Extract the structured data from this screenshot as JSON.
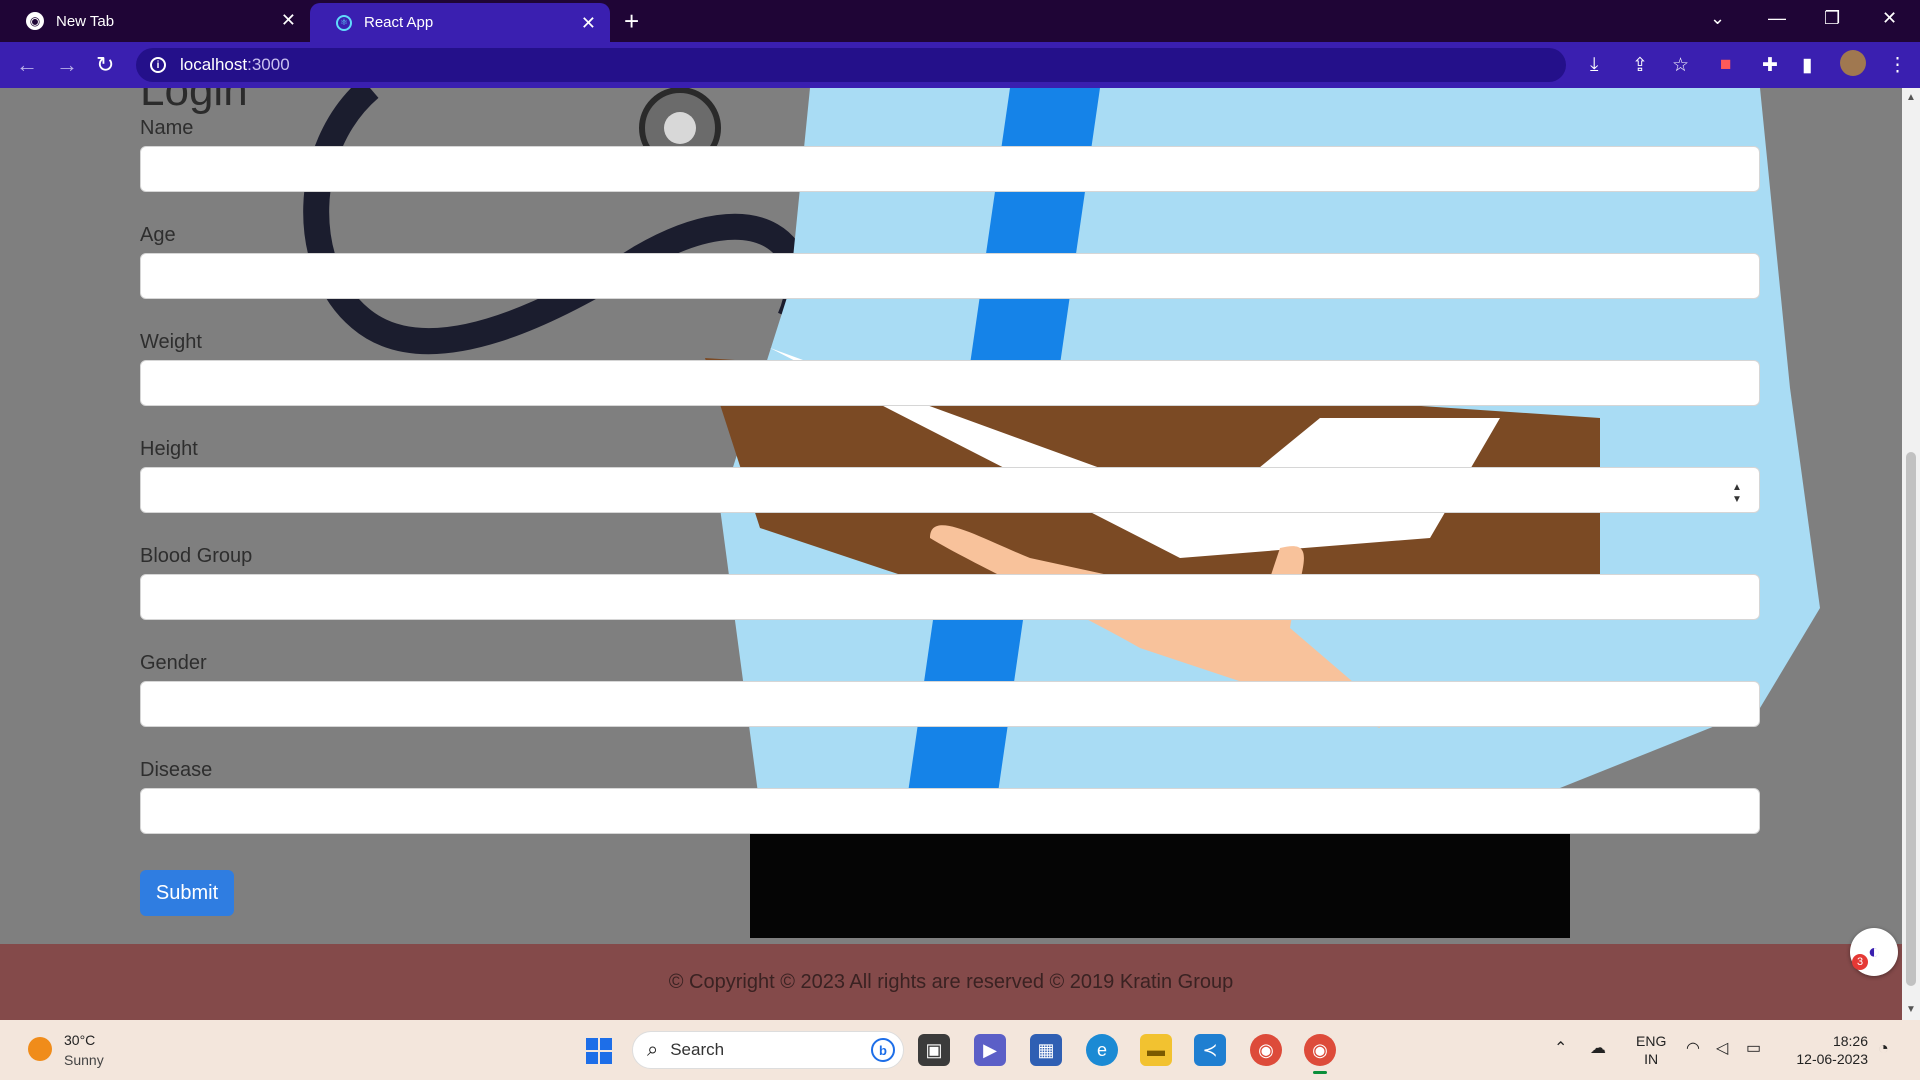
{
  "browser": {
    "tabs": [
      {
        "title": "New Tab",
        "icon": "chrome-icon",
        "active": false
      },
      {
        "title": "React App",
        "icon": "react-icon",
        "active": true
      }
    ],
    "url_host": "localhost",
    "url_port": ":3000",
    "accent_color": "#3a1fb0"
  },
  "page": {
    "title": "Login",
    "form": {
      "fields": [
        {
          "label": "Name",
          "value": ""
        },
        {
          "label": "Age",
          "value": ""
        },
        {
          "label": "Weight",
          "value": ""
        },
        {
          "label": "Height",
          "value": "",
          "type": "number"
        },
        {
          "label": "Blood Group",
          "value": ""
        },
        {
          "label": "Gender",
          "value": ""
        },
        {
          "label": "Disease",
          "value": ""
        }
      ],
      "submit_label": "Submit"
    },
    "footer": "© Copyright © 2023 All rights are reserved © 2019 Kratin Group",
    "float_badge": "3"
  },
  "taskbar": {
    "weather_temp": "30°C",
    "weather_cond": "Sunny",
    "search_label": "Search",
    "lang_top": "ENG",
    "lang_bottom": "IN",
    "time": "18:26",
    "date": "12-06-2023"
  }
}
